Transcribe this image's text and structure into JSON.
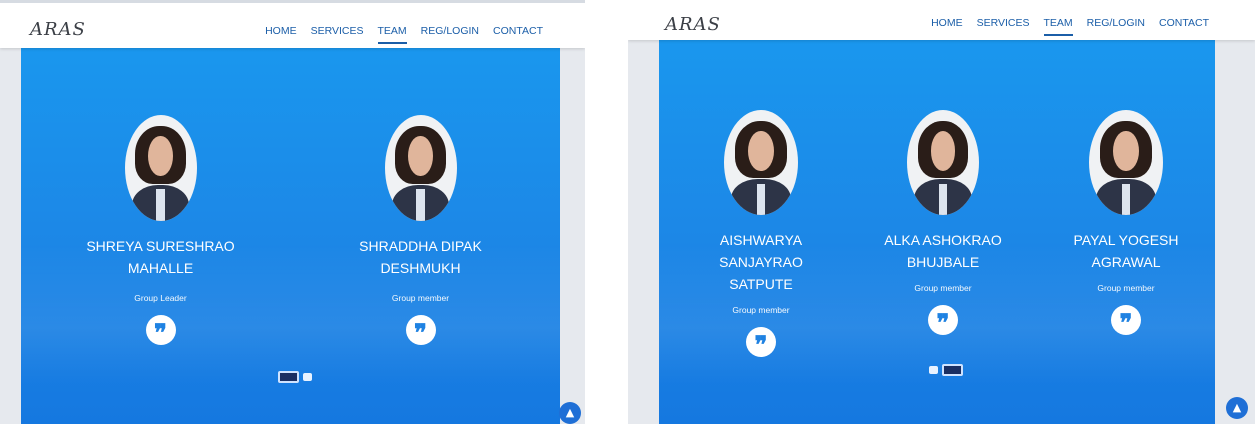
{
  "screens": [
    {
      "logo": "ARAS",
      "nav": [
        "HOME",
        "SERVICES",
        "TEAM",
        "REG/LOGIN",
        "CONTACT"
      ],
      "active_nav": "TEAM",
      "members": [
        {
          "name": "SHREYA SURESHRAO MAHALLE",
          "role": "Group Leader",
          "quote_icon": "quote-icon"
        },
        {
          "name": "SHRADDHA DIPAK DESHMUKH",
          "role": "Group member",
          "quote_icon": "quote-icon"
        }
      ],
      "carousel_active_index": 0
    },
    {
      "logo": "ARAS",
      "nav": [
        "HOME",
        "SERVICES",
        "TEAM",
        "REG/LOGIN",
        "CONTACT"
      ],
      "active_nav": "TEAM",
      "members": [
        {
          "name_line1": "AISHWARYA SANJAYRAO",
          "name_line2": "SATPUTE",
          "role": "Group member",
          "quote_icon": "quote-icon"
        },
        {
          "name_line1": "ALKA ASHOKRAO",
          "name_line2": "BHUJBALE",
          "role": "Group member",
          "quote_icon": "quote-icon"
        },
        {
          "name_line1": "PAYAL YOGESH",
          "name_line2": "AGRAWAL",
          "role": "Group member",
          "quote_icon": "quote-icon"
        }
      ],
      "carousel_active_index": 1
    }
  ],
  "colors": {
    "hero_top": "#1a97ee",
    "hero_bottom": "#1578e0",
    "nav_text": "#1b5ea8",
    "back_to_top": "#1f6fd6"
  },
  "icons": {
    "quote": "quote-icon",
    "back_to_top": "chevron-up-icon"
  }
}
